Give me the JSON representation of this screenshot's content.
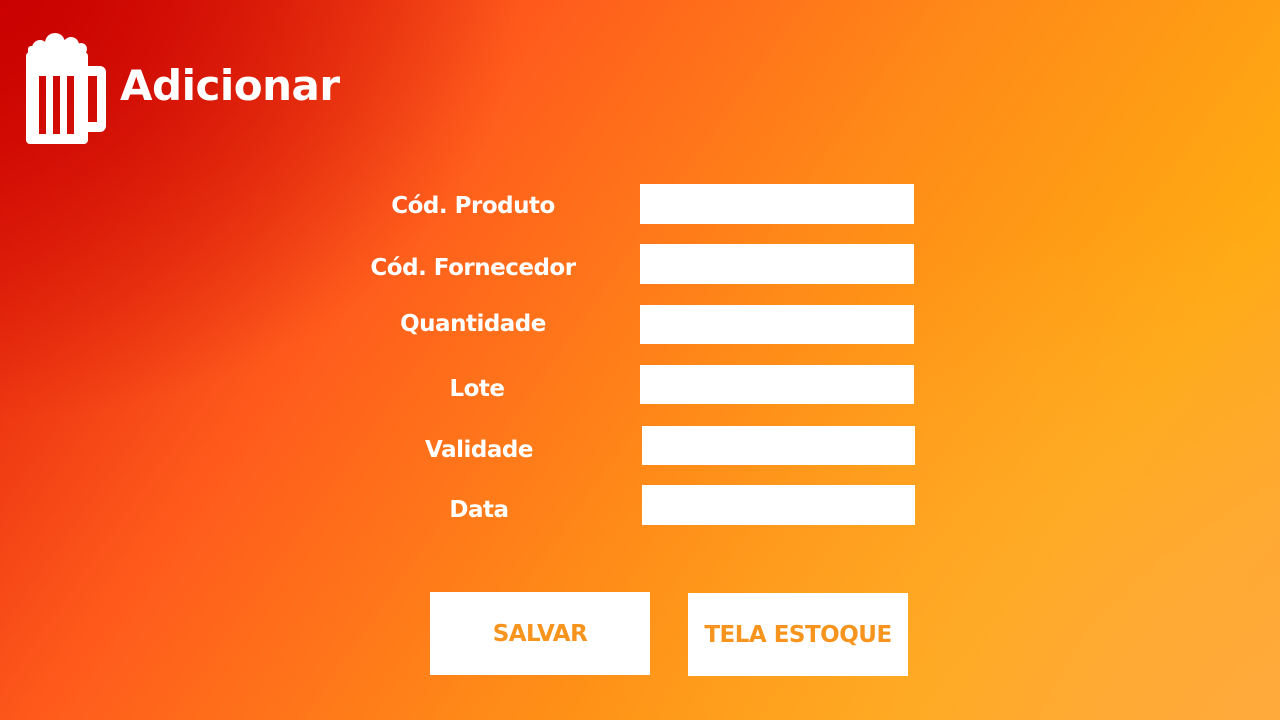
{
  "header": {
    "icon": "beer-mug-icon",
    "title": "Adicionar"
  },
  "form": {
    "fields": [
      {
        "label": "Cód. Produto",
        "value": "",
        "placeholder": ""
      },
      {
        "label": "Cód. Fornecedor",
        "value": "",
        "placeholder": ""
      },
      {
        "label": "Quantidade",
        "value": "",
        "placeholder": ""
      },
      {
        "label": "Lote",
        "value": "",
        "placeholder": ""
      },
      {
        "label": "Validade",
        "value": "",
        "placeholder": ""
      },
      {
        "label": "Data",
        "value": "",
        "placeholder": ""
      }
    ]
  },
  "actions": {
    "save_label": "SALVAR",
    "stock_screen_label": "TELA ESTOQUE"
  },
  "colors": {
    "background_start": "#d90f05",
    "background_mid": "#ff8a18",
    "background_end": "#ffab12",
    "button_text": "#f7941d",
    "text": "#ffffff",
    "input_background": "#ffffff"
  }
}
